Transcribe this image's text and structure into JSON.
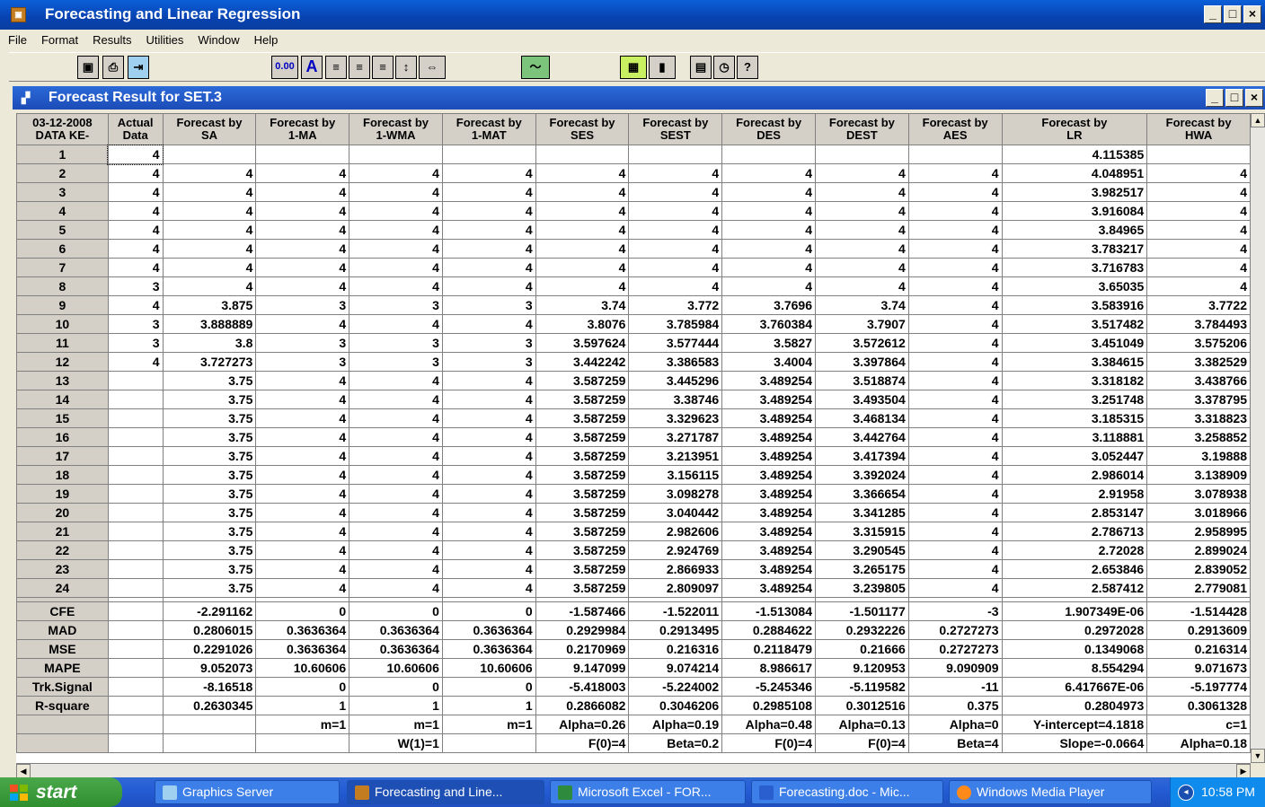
{
  "window": {
    "title": "Forecasting and Linear Regression"
  },
  "menu": [
    "File",
    "Format",
    "Results",
    "Utilities",
    "Window",
    "Help"
  ],
  "toolbar": {
    "number_format_label": "0.00"
  },
  "child": {
    "title": "Forecast Result for SET.3"
  },
  "table": {
    "headers": [
      [
        "03-12-2008",
        "DATA KE-"
      ],
      [
        "Actual",
        "Data"
      ],
      [
        "Forecast by",
        "SA"
      ],
      [
        "Forecast by",
        "1-MA"
      ],
      [
        "Forecast by",
        "1-WMA"
      ],
      [
        "Forecast by",
        "1-MAT"
      ],
      [
        "Forecast by",
        "SES"
      ],
      [
        "Forecast by",
        "SEST"
      ],
      [
        "Forecast by",
        "DES"
      ],
      [
        "Forecast by",
        "DEST"
      ],
      [
        "Forecast by",
        "AES"
      ],
      [
        "Forecast by",
        "LR"
      ],
      [
        "Forecast by",
        "HWA"
      ]
    ],
    "rows": [
      [
        "1",
        "4",
        "",
        "",
        "",
        "",
        "",
        "",
        "",
        "",
        "",
        "4.115385",
        ""
      ],
      [
        "2",
        "4",
        "4",
        "4",
        "4",
        "4",
        "4",
        "4",
        "4",
        "4",
        "4",
        "4.048951",
        "4"
      ],
      [
        "3",
        "4",
        "4",
        "4",
        "4",
        "4",
        "4",
        "4",
        "4",
        "4",
        "4",
        "3.982517",
        "4"
      ],
      [
        "4",
        "4",
        "4",
        "4",
        "4",
        "4",
        "4",
        "4",
        "4",
        "4",
        "4",
        "3.916084",
        "4"
      ],
      [
        "5",
        "4",
        "4",
        "4",
        "4",
        "4",
        "4",
        "4",
        "4",
        "4",
        "4",
        "3.84965",
        "4"
      ],
      [
        "6",
        "4",
        "4",
        "4",
        "4",
        "4",
        "4",
        "4",
        "4",
        "4",
        "4",
        "3.783217",
        "4"
      ],
      [
        "7",
        "4",
        "4",
        "4",
        "4",
        "4",
        "4",
        "4",
        "4",
        "4",
        "4",
        "3.716783",
        "4"
      ],
      [
        "8",
        "3",
        "4",
        "4",
        "4",
        "4",
        "4",
        "4",
        "4",
        "4",
        "4",
        "3.65035",
        "4"
      ],
      [
        "9",
        "4",
        "3.875",
        "3",
        "3",
        "3",
        "3.74",
        "3.772",
        "3.7696",
        "3.74",
        "4",
        "3.583916",
        "3.7722"
      ],
      [
        "10",
        "3",
        "3.888889",
        "4",
        "4",
        "4",
        "3.8076",
        "3.785984",
        "3.760384",
        "3.7907",
        "4",
        "3.517482",
        "3.784493"
      ],
      [
        "11",
        "3",
        "3.8",
        "3",
        "3",
        "3",
        "3.597624",
        "3.577444",
        "3.5827",
        "3.572612",
        "4",
        "3.451049",
        "3.575206"
      ],
      [
        "12",
        "4",
        "3.727273",
        "3",
        "3",
        "3",
        "3.442242",
        "3.386583",
        "3.4004",
        "3.397864",
        "4",
        "3.384615",
        "3.382529"
      ],
      [
        "13",
        "",
        "3.75",
        "4",
        "4",
        "4",
        "3.587259",
        "3.445296",
        "3.489254",
        "3.518874",
        "4",
        "3.318182",
        "3.438766"
      ],
      [
        "14",
        "",
        "3.75",
        "4",
        "4",
        "4",
        "3.587259",
        "3.38746",
        "3.489254",
        "3.493504",
        "4",
        "3.251748",
        "3.378795"
      ],
      [
        "15",
        "",
        "3.75",
        "4",
        "4",
        "4",
        "3.587259",
        "3.329623",
        "3.489254",
        "3.468134",
        "4",
        "3.185315",
        "3.318823"
      ],
      [
        "16",
        "",
        "3.75",
        "4",
        "4",
        "4",
        "3.587259",
        "3.271787",
        "3.489254",
        "3.442764",
        "4",
        "3.118881",
        "3.258852"
      ],
      [
        "17",
        "",
        "3.75",
        "4",
        "4",
        "4",
        "3.587259",
        "3.213951",
        "3.489254",
        "3.417394",
        "4",
        "3.052447",
        "3.19888"
      ],
      [
        "18",
        "",
        "3.75",
        "4",
        "4",
        "4",
        "3.587259",
        "3.156115",
        "3.489254",
        "3.392024",
        "4",
        "2.986014",
        "3.138909"
      ],
      [
        "19",
        "",
        "3.75",
        "4",
        "4",
        "4",
        "3.587259",
        "3.098278",
        "3.489254",
        "3.366654",
        "4",
        "2.91958",
        "3.078938"
      ],
      [
        "20",
        "",
        "3.75",
        "4",
        "4",
        "4",
        "3.587259",
        "3.040442",
        "3.489254",
        "3.341285",
        "4",
        "2.853147",
        "3.018966"
      ],
      [
        "21",
        "",
        "3.75",
        "4",
        "4",
        "4",
        "3.587259",
        "2.982606",
        "3.489254",
        "3.315915",
        "4",
        "2.786713",
        "2.958995"
      ],
      [
        "22",
        "",
        "3.75",
        "4",
        "4",
        "4",
        "3.587259",
        "2.924769",
        "3.489254",
        "3.290545",
        "4",
        "2.72028",
        "2.899024"
      ],
      [
        "23",
        "",
        "3.75",
        "4",
        "4",
        "4",
        "3.587259",
        "2.866933",
        "3.489254",
        "3.265175",
        "4",
        "2.653846",
        "2.839052"
      ],
      [
        "24",
        "",
        "3.75",
        "4",
        "4",
        "4",
        "3.587259",
        "2.809097",
        "3.489254",
        "3.239805",
        "4",
        "2.587412",
        "2.779081"
      ]
    ],
    "stats": [
      [
        "CFE",
        "",
        "-2.291162",
        "0",
        "0",
        "0",
        "-1.587466",
        "-1.522011",
        "-1.513084",
        "-1.501177",
        "-3",
        "1.907349E-06",
        "-1.514428"
      ],
      [
        "MAD",
        "",
        "0.2806015",
        "0.3636364",
        "0.3636364",
        "0.3636364",
        "0.2929984",
        "0.2913495",
        "0.2884622",
        "0.2932226",
        "0.2727273",
        "0.2972028",
        "0.2913609"
      ],
      [
        "MSE",
        "",
        "0.2291026",
        "0.3636364",
        "0.3636364",
        "0.3636364",
        "0.2170969",
        "0.216316",
        "0.2118479",
        "0.21666",
        "0.2727273",
        "0.1349068",
        "0.216314"
      ],
      [
        "MAPE",
        "",
        "9.052073",
        "10.60606",
        "10.60606",
        "10.60606",
        "9.147099",
        "9.074214",
        "8.986617",
        "9.120953",
        "9.090909",
        "8.554294",
        "9.071673"
      ],
      [
        "Trk.Signal",
        "",
        "-8.16518",
        "0",
        "0",
        "0",
        "-5.418003",
        "-5.224002",
        "-5.245346",
        "-5.119582",
        "-11",
        "6.417667E-06",
        "-5.197774"
      ],
      [
        "R-square",
        "",
        "0.2630345",
        "1",
        "1",
        "1",
        "0.2866082",
        "0.3046206",
        "0.2985108",
        "0.3012516",
        "0.375",
        "0.2804973",
        "0.3061328"
      ],
      [
        "",
        "",
        "",
        "m=1",
        "m=1",
        "m=1",
        "Alpha=0.26",
        "Alpha=0.19",
        "Alpha=0.48",
        "Alpha=0.13",
        "Alpha=0",
        "Y-intercept=4.1818",
        "c=1"
      ],
      [
        "",
        "",
        "",
        "",
        "W(1)=1",
        "",
        "F(0)=4",
        "Beta=0.2",
        "F(0)=4",
        "F(0)=4",
        "Beta=4",
        "Slope=-0.0664",
        "Alpha=0.18"
      ]
    ]
  },
  "taskbar": {
    "start_label": "start",
    "tasks": [
      "Graphics Server",
      "Forecasting and Line...",
      "Microsoft Excel - FOR...",
      "Forecasting.doc - Mic...",
      "Windows Media Player"
    ],
    "clock": "10:58 PM"
  }
}
